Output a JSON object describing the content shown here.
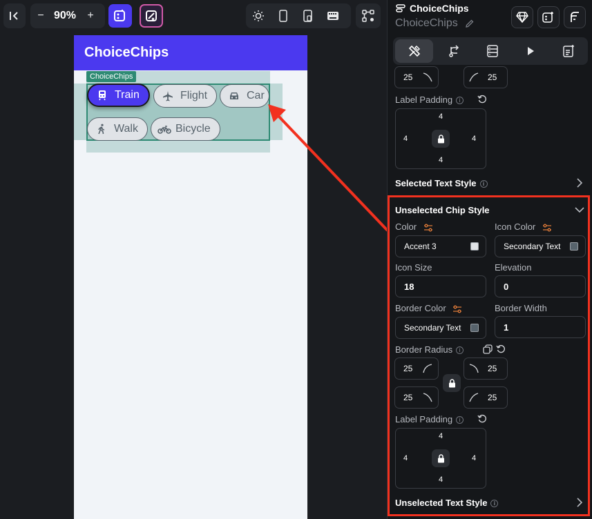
{
  "toolbar": {
    "zoom": "90%",
    "zoom_minus": "−",
    "zoom_plus": "+"
  },
  "preview": {
    "appbar_title": "ChoiceChips",
    "widget_tag": "ChoiceChips",
    "chips": [
      {
        "label": "Train",
        "icon": "train-icon",
        "selected": true
      },
      {
        "label": "Flight",
        "icon": "airplane-icon",
        "selected": false
      },
      {
        "label": "Car",
        "icon": "car-icon",
        "selected": false
      },
      {
        "label": "Walk",
        "icon": "walking-person-icon",
        "selected": false
      },
      {
        "label": "Bicycle",
        "icon": "motorcycle-icon",
        "selected": false
      }
    ]
  },
  "panel": {
    "widget_type": "ChoiceChips",
    "widget_name": "ChoiceChips",
    "top_radius": {
      "left": "25",
      "right": "25"
    },
    "selected_label_padding": {
      "label": "Label Padding",
      "top": "4",
      "left": "4",
      "right": "4",
      "bottom": "4"
    },
    "selected_text_style": "Selected Text Style",
    "unselected": {
      "title": "Unselected Chip Style",
      "color_label": "Color",
      "color_value": "Accent 3",
      "icon_color_label": "Icon Color",
      "icon_color_value": "Secondary Text",
      "icon_size_label": "Icon Size",
      "icon_size_value": "18",
      "elevation_label": "Elevation",
      "elevation_value": "0",
      "border_color_label": "Border Color",
      "border_color_value": "Secondary Text",
      "border_width_label": "Border Width",
      "border_width_value": "1",
      "border_radius_label": "Border Radius",
      "radius": {
        "top_left": "25",
        "top_right": "25",
        "bottom_left": "25",
        "bottom_right": "25"
      },
      "label_padding_label": "Label Padding",
      "padding": {
        "top": "4",
        "left": "4",
        "right": "4",
        "bottom": "4"
      },
      "text_style": "Unselected Text Style"
    }
  },
  "colors": {
    "brand": "#4b39ef",
    "highlight": "#f2311f",
    "accent3_swatch": "#e0e3e7",
    "secondary_text_swatch": "#57636c"
  }
}
